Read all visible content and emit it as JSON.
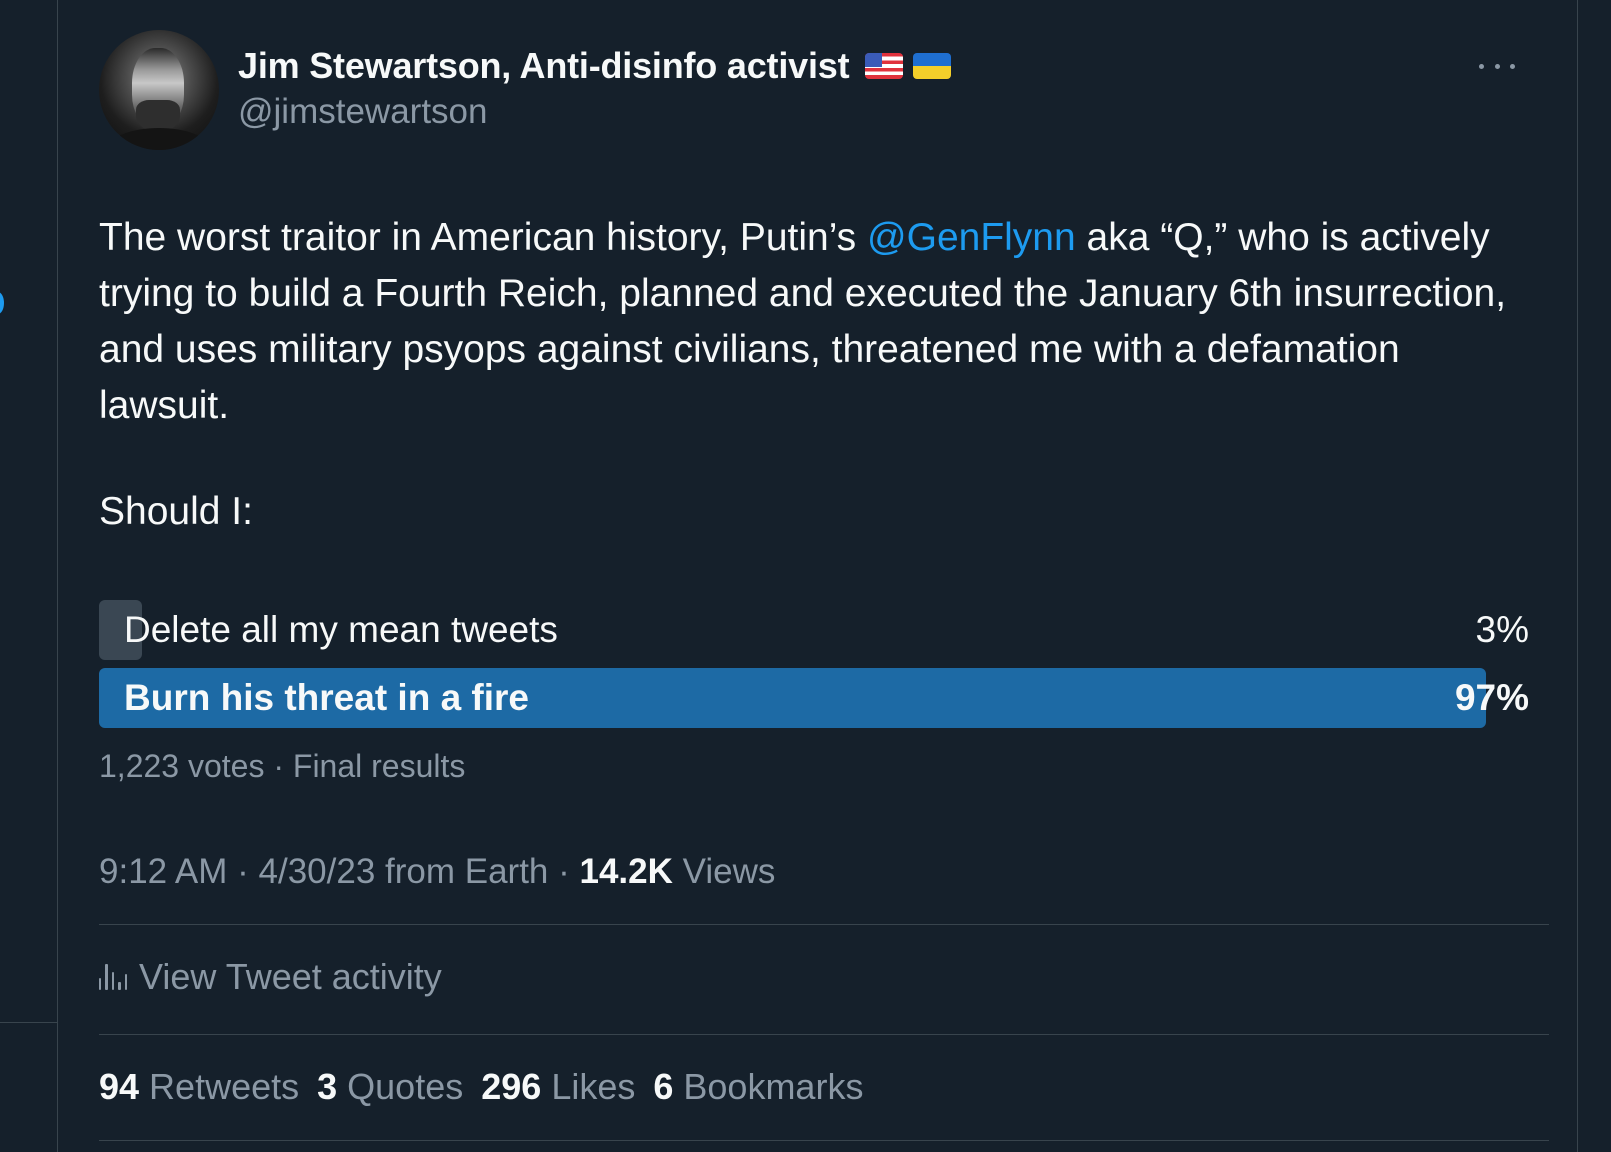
{
  "author": {
    "display_name": "Jim Stewartson, Anti-disinfo activist",
    "handle": "@jimstewartson",
    "badges": [
      "us-flag-icon",
      "ukraine-flag-icon"
    ]
  },
  "tweet": {
    "text_before": "The worst traitor in American history, Putin’s ",
    "mention": "@GenFlynn",
    "text_after": " aka “Q,” who is actively trying to build a Fourth Reich, planned and executed the January 6th insurrection, and uses military psyops against civilians, threatened me with a defamation lawsuit.",
    "question": "Should I:"
  },
  "poll": {
    "options": [
      {
        "label": "Delete all my mean tweets",
        "percent_text": "3%",
        "percent": 3,
        "winner": false
      },
      {
        "label": "Burn his threat in a fire",
        "percent_text": "97%",
        "percent": 97,
        "winner": true
      }
    ],
    "footer": "1,223 votes · Final results"
  },
  "meta": {
    "time_source": "9:12 AM · 4/30/23 from Earth · ",
    "views_count": "14.2K",
    "views_label": " Views"
  },
  "activity": {
    "label": "View Tweet activity"
  },
  "stats": {
    "retweets": {
      "num": "94",
      "label": "Retweets"
    },
    "quotes": {
      "num": "3",
      "label": "Quotes"
    },
    "likes": {
      "num": "296",
      "label": "Likes"
    },
    "bookmarks": {
      "num": "6",
      "label": "Bookmarks"
    }
  },
  "colors": {
    "background": "#15202b",
    "link": "#1d9bf0",
    "winner_bar": "#1d6aa5",
    "loser_bar": "#3a4753",
    "muted_text": "#8b98a5"
  }
}
